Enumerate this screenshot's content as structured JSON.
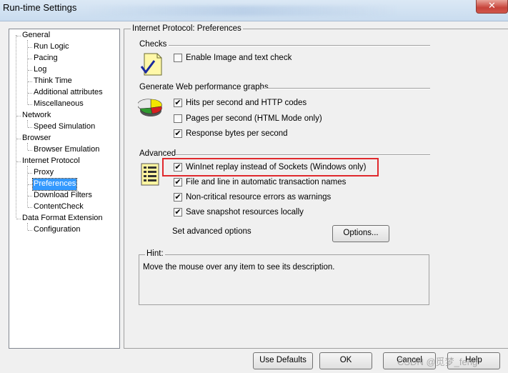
{
  "window": {
    "title": "Run-time Settings",
    "close_glyph": "✕"
  },
  "tree": {
    "items": [
      {
        "label": "General",
        "level": 0,
        "selected": false
      },
      {
        "label": "Run Logic",
        "level": 1,
        "selected": false
      },
      {
        "label": "Pacing",
        "level": 1,
        "selected": false
      },
      {
        "label": "Log",
        "level": 1,
        "selected": false
      },
      {
        "label": "Think Time",
        "level": 1,
        "selected": false
      },
      {
        "label": "Additional attributes",
        "level": 1,
        "selected": false
      },
      {
        "label": "Miscellaneous",
        "level": 1,
        "selected": false
      },
      {
        "label": "Network",
        "level": 0,
        "selected": false
      },
      {
        "label": "Speed Simulation",
        "level": 1,
        "selected": false
      },
      {
        "label": "Browser",
        "level": 0,
        "selected": false
      },
      {
        "label": "Browser Emulation",
        "level": 1,
        "selected": false
      },
      {
        "label": "Internet Protocol",
        "level": 0,
        "selected": false
      },
      {
        "label": "Proxy",
        "level": 1,
        "selected": false
      },
      {
        "label": "Preferences",
        "level": 1,
        "selected": true
      },
      {
        "label": "Download Filters",
        "level": 1,
        "selected": false
      },
      {
        "label": "ContentCheck",
        "level": 1,
        "selected": false
      },
      {
        "label": "Data Format Extension",
        "level": 0,
        "selected": false
      },
      {
        "label": "Configuration",
        "level": 1,
        "selected": false
      }
    ]
  },
  "panel": {
    "caption": "Internet Protocol: Preferences",
    "checks": {
      "label": "Checks",
      "enable_image": {
        "label": "Enable Image and text check",
        "checked": false
      }
    },
    "graphs": {
      "label": "Generate Web performance graphs",
      "hits": {
        "label": "Hits per second and HTTP codes",
        "checked": true
      },
      "pages": {
        "label": "Pages per second (HTML Mode only)",
        "checked": false
      },
      "response": {
        "label": "Response bytes per second",
        "checked": true
      }
    },
    "advanced": {
      "label": "Advanced",
      "wininet": {
        "label": "WinInet replay instead of Sockets (Windows only)",
        "checked": true
      },
      "file_line": {
        "label": "File and line in automatic transaction names",
        "checked": true
      },
      "noncritical": {
        "label": "Non-critical resource errors as warnings",
        "checked": true
      },
      "snapshot": {
        "label": "Save snapshot resources locally",
        "checked": true
      },
      "set_advanced_label": "Set advanced options",
      "options_button": "Options..."
    },
    "hint": {
      "caption": "Hint:",
      "text": "Move the mouse over any item to see its description."
    }
  },
  "buttons": {
    "use_defaults": "Use Defaults",
    "ok": "OK",
    "cancel": "Cancel",
    "help": "Help"
  },
  "watermark": "CSDN @觅梦_feng",
  "colors": {
    "highlight": "#e0292d",
    "selection": "#3399ff"
  }
}
